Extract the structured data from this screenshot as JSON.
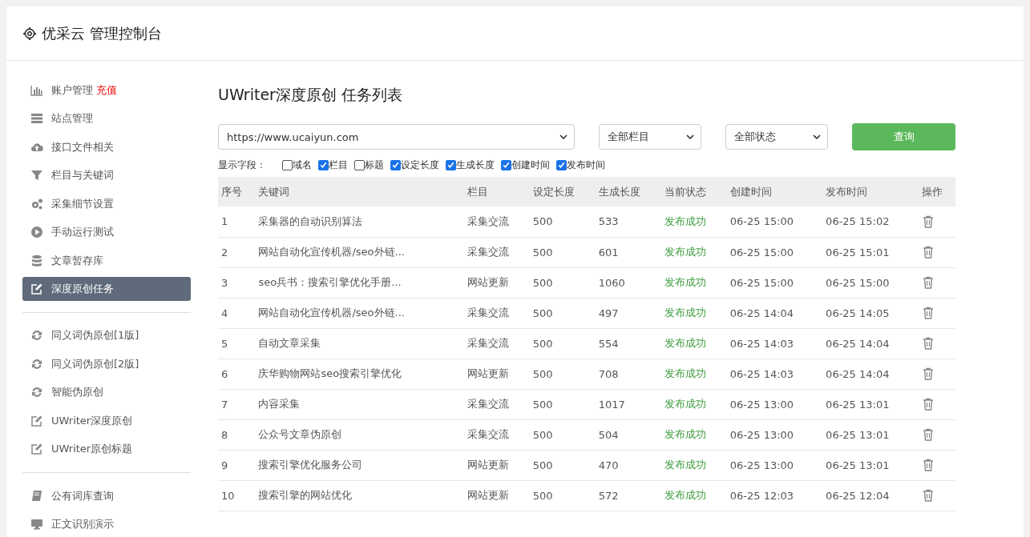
{
  "header": {
    "title": "优采云 管理控制台"
  },
  "sidebar": {
    "groups": [
      {
        "items": [
          {
            "label": "账户管理",
            "badge": "充值",
            "selected": false
          },
          {
            "label": "站点管理",
            "selected": false
          },
          {
            "label": "接口文件相关",
            "selected": false
          },
          {
            "label": "栏目与关键词",
            "selected": false
          },
          {
            "label": "采集细节设置",
            "selected": false
          },
          {
            "label": "手动运行测试",
            "selected": false
          },
          {
            "label": "文章暂存库",
            "selected": false
          },
          {
            "label": "深度原创任务",
            "selected": true
          }
        ]
      },
      {
        "items": [
          {
            "label": "同义词伪原创[1版]",
            "selected": false
          },
          {
            "label": "同义词伪原创[2版]",
            "selected": false
          },
          {
            "label": "智能伪原创",
            "selected": false
          },
          {
            "label": "UWriter深度原创",
            "selected": false
          },
          {
            "label": "UWriter原创标题",
            "selected": false
          }
        ]
      },
      {
        "items": [
          {
            "label": "公有词库查询",
            "selected": false
          },
          {
            "label": "正文识别演示",
            "selected": false
          }
        ]
      }
    ]
  },
  "main": {
    "title": "UWriter深度原创 任务列表",
    "filters": {
      "site": "https://www.ucaiyun.com",
      "column": "全部栏目",
      "status": "全部状态",
      "query_button": "查询"
    },
    "fields_label": "显示字段：",
    "fields": [
      {
        "label": "域名",
        "checked": false
      },
      {
        "label": "栏目",
        "checked": true
      },
      {
        "label": "标题",
        "checked": false
      },
      {
        "label": "设定长度",
        "checked": true
      },
      {
        "label": "生成长度",
        "checked": true
      },
      {
        "label": "创建时间",
        "checked": true
      },
      {
        "label": "发布时间",
        "checked": true
      }
    ],
    "table": {
      "columns": [
        "序号",
        "关键词",
        "栏目",
        "设定长度",
        "生成长度",
        "当前状态",
        "创建时间",
        "发布时间",
        "操作"
      ],
      "rows": [
        [
          "1",
          "采集器的自动识别算法",
          "采集交流",
          "500",
          "533",
          "发布成功",
          "06-25 15:00",
          "06-25 15:02"
        ],
        [
          "2",
          "网站自动化宣传机器/seo外链...",
          "采集交流",
          "500",
          "601",
          "发布成功",
          "06-25 15:00",
          "06-25 15:01"
        ],
        [
          "3",
          "seo兵书：搜索引擎优化手册...",
          "网站更新",
          "500",
          "1060",
          "发布成功",
          "06-25 15:00",
          "06-25 15:00"
        ],
        [
          "4",
          "网站自动化宣传机器/seo外链...",
          "采集交流",
          "500",
          "497",
          "发布成功",
          "06-25 14:04",
          "06-25 14:05"
        ],
        [
          "5",
          "自动文章采集",
          "采集交流",
          "500",
          "554",
          "发布成功",
          "06-25 14:03",
          "06-25 14:04"
        ],
        [
          "6",
          "庆华购物网站seo搜索引擎优化",
          "网站更新",
          "500",
          "708",
          "发布成功",
          "06-25 14:03",
          "06-25 14:04"
        ],
        [
          "7",
          "内容采集",
          "采集交流",
          "500",
          "1017",
          "发布成功",
          "06-25 13:00",
          "06-25 13:01"
        ],
        [
          "8",
          "公众号文章伪原创",
          "采集交流",
          "500",
          "504",
          "发布成功",
          "06-25 13:00",
          "06-25 13:01"
        ],
        [
          "9",
          "搜索引擎优化服务公司",
          "网站更新",
          "500",
          "470",
          "发布成功",
          "06-25 13:00",
          "06-25 13:01"
        ],
        [
          "10",
          "搜索引擎的网站优化",
          "网站更新",
          "500",
          "572",
          "发布成功",
          "06-25 12:03",
          "06-25 12:04"
        ]
      ]
    }
  }
}
